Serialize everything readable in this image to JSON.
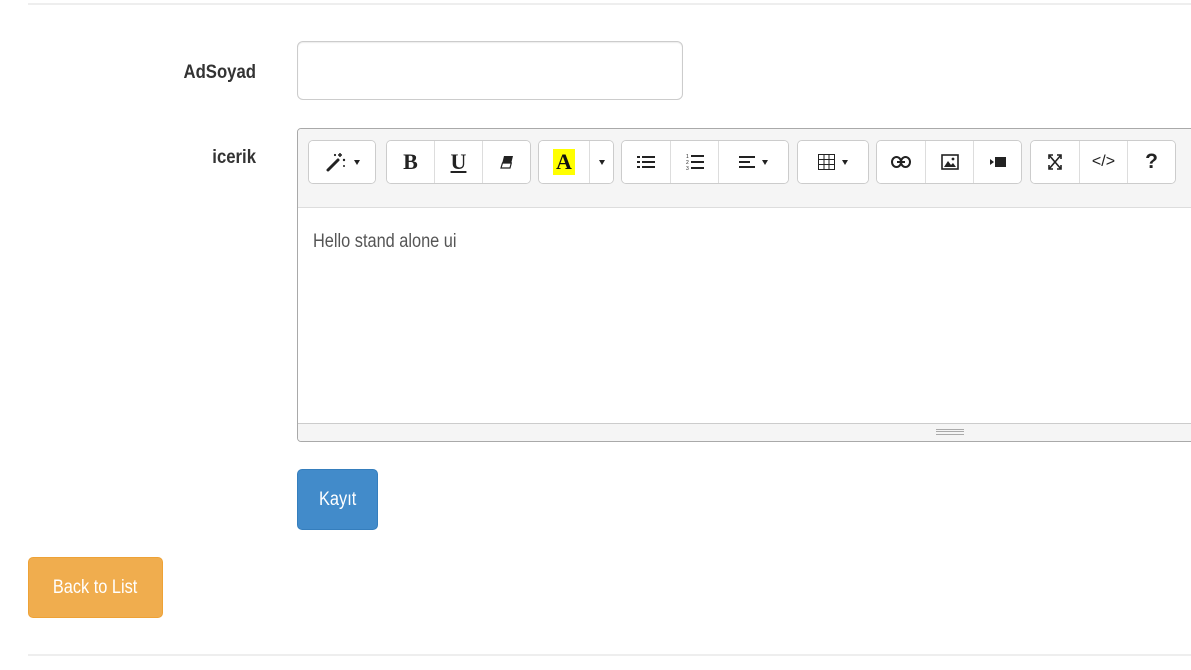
{
  "form": {
    "name_label": "AdSoyad",
    "name_value": "",
    "content_label": "icerik"
  },
  "editor": {
    "toolbar": {
      "style": "style-magic-icon",
      "bold": "B",
      "underline": "U",
      "clear": "eraser-icon",
      "color": "A",
      "unordered_list": "list-ul-icon",
      "ordered_list": "list-ol-icon",
      "paragraph": "align-left-icon",
      "table": "table-icon",
      "link": "link-icon",
      "picture": "picture-icon",
      "video": "video-icon",
      "fullscreen": "fullscreen-icon",
      "codeview": "</>",
      "help": "?"
    },
    "content": "Hello stand alone ui"
  },
  "buttons": {
    "save": "Kayıt",
    "back": "Back to List"
  },
  "colors": {
    "primary": "#428bca",
    "warning": "#f0ad4e",
    "highlight": "#ffff00"
  }
}
